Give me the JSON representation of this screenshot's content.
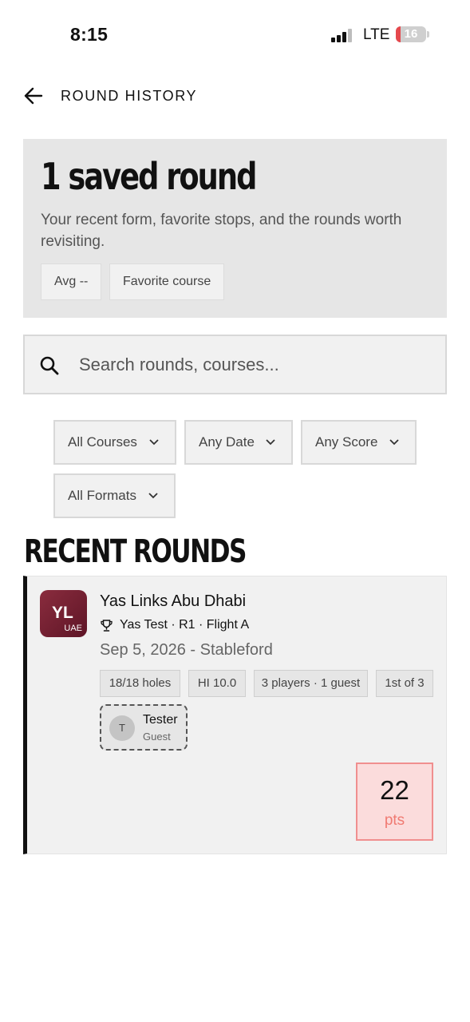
{
  "status_bar": {
    "time": "8:15",
    "network": "LTE",
    "battery": "16",
    "battery_level_percent": 16,
    "battery_color": "#e5484d"
  },
  "header": {
    "back_icon": "arrow-left-icon",
    "title": "ROUND HISTORY"
  },
  "summary": {
    "title": "1 saved round",
    "subtitle": "Your recent form, favorite stops, and the rounds worth revisiting.",
    "chips": [
      "Avg --",
      "Favorite course"
    ]
  },
  "search": {
    "icon": "search-icon",
    "placeholder": "Search rounds, courses..."
  },
  "filters": [
    {
      "label": "All Courses",
      "icon": "chevron-down-icon"
    },
    {
      "label": "Any Date",
      "icon": "chevron-down-icon"
    },
    {
      "label": "Any Score",
      "icon": "chevron-down-icon"
    },
    {
      "label": "All Formats",
      "icon": "chevron-down-icon"
    }
  ],
  "recent": {
    "section_title": "RECENT ROUNDS",
    "rounds": [
      {
        "logo": {
          "initials": "YL",
          "country": "UAE",
          "color": "#7a2233"
        },
        "course": "Yas Links Abu Dhabi",
        "event_icon": "trophy-icon",
        "event": "Yas Test · R1 · Flight A",
        "date_format": "Sep 5, 2026 - Stableford",
        "tags": [
          "18/18 holes",
          "HI 10.0",
          "3 players · 1 guest",
          "1st of 3"
        ],
        "players": [
          {
            "initial": "T",
            "name": "Tester",
            "role": "Guest"
          }
        ],
        "score": {
          "value": "22",
          "unit": "pts",
          "accent": "#f07a72"
        }
      }
    ]
  }
}
